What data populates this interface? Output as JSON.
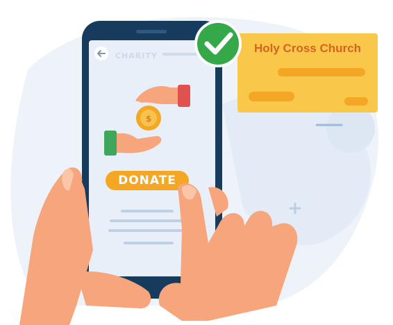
{
  "app_bar": {
    "title": "CHARITY"
  },
  "donate_button": {
    "label": "DONATE"
  },
  "payment_card": {
    "name": "Holy Cross Church"
  },
  "icons": {
    "back": "arrow-left-icon",
    "coin": "dollar-coin-icon",
    "check": "checkmark-icon",
    "hand_giving": "giving-hand-icon",
    "hand_receiving": "receiving-hand-icon"
  },
  "colors": {
    "phone_frame": "#163b5c",
    "screen": "#e9eff8",
    "card": "#f9c84b",
    "card_text": "#d6631e",
    "check_badge": "#35a84a",
    "button": "#f5a623",
    "skin": "#f6a57c"
  }
}
